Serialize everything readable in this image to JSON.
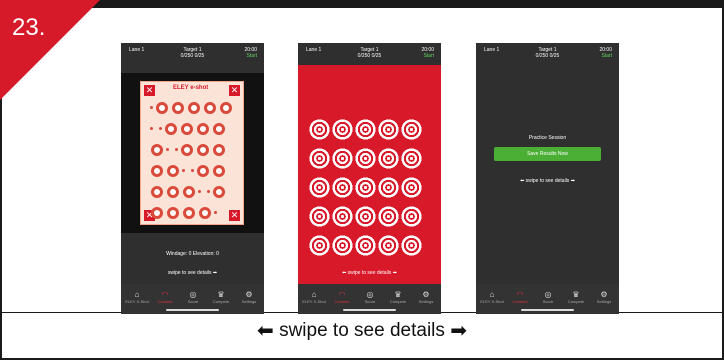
{
  "step_number": "23.",
  "colors": {
    "brand_red": "#d7192a",
    "dark": "#2f2f2f",
    "green": "#4caf35"
  },
  "header": {
    "lane": "Lane 1",
    "target": "Target 1",
    "score": "0/250 0/25",
    "time": "20:00",
    "start": "Start"
  },
  "phone1": {
    "brand": "ELEY e-shot",
    "windage": "Windage: 0 Elevation: 0",
    "swipe": "swipe to see details"
  },
  "phone2": {
    "swipe": "swipe to see details"
  },
  "phone3": {
    "practice": "Practice Session",
    "save_button": "Save Results Now",
    "swipe": "swipe to see details"
  },
  "tabs": [
    {
      "label": "ELEY X-Shot",
      "icon": "home-icon"
    },
    {
      "label": "Connect",
      "icon": "wifi-icon"
    },
    {
      "label": "Score",
      "icon": "target-icon"
    },
    {
      "label": "Compete",
      "icon": "trophy-icon"
    },
    {
      "label": "Settings",
      "icon": "gear-icon"
    }
  ],
  "swipe_caption": "swipe to see details"
}
